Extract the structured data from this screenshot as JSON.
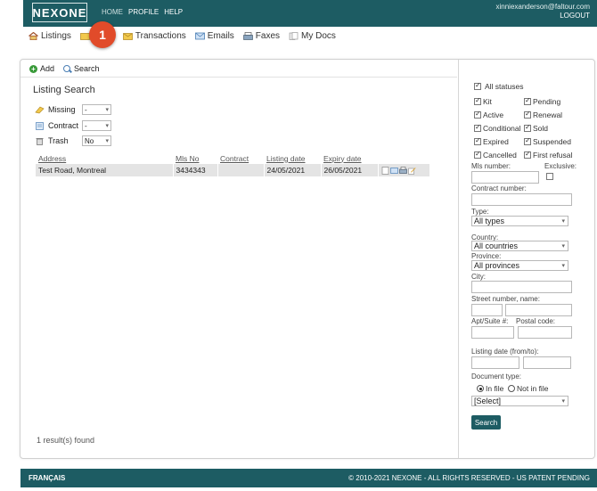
{
  "header": {
    "logo": "NEXONE",
    "nav": [
      "HOME",
      "PROFILE",
      "HELP"
    ],
    "user_email": "xinniexanderson@faltour.com",
    "logout": "LOGOUT"
  },
  "subnav": {
    "items": [
      {
        "label": "Listings",
        "icon": "house-icon"
      },
      {
        "label": "",
        "icon": "folder-icon"
      },
      {
        "label": "Transactions",
        "icon": "envelope-folder-icon"
      },
      {
        "label": "Emails",
        "icon": "email-icon"
      },
      {
        "label": "Faxes",
        "icon": "fax-icon"
      },
      {
        "label": "My Docs",
        "icon": "docs-icon"
      }
    ],
    "badge": "1"
  },
  "toolbar": {
    "add": "Add",
    "search": "Search"
  },
  "listing_search": {
    "title": "Listing Search",
    "filters": [
      {
        "label": "Missing",
        "value": "-"
      },
      {
        "label": "Contract",
        "value": "-"
      },
      {
        "label": "Trash",
        "value": "No"
      }
    ]
  },
  "results": {
    "columns": [
      "Address",
      "Mls No",
      "Contract",
      "Listing date",
      "Expiry date"
    ],
    "rows": [
      {
        "address": "Test Road, Montreal",
        "mls": "3434343",
        "contract": "",
        "listing_date": "24/05/2021",
        "expiry_date": "26/05/2021"
      }
    ],
    "count_text": "1 result(s) found"
  },
  "side": {
    "all_statuses": "All statuses",
    "statuses": [
      {
        "label": "Kit",
        "checked": true
      },
      {
        "label": "Pending",
        "checked": true
      },
      {
        "label": "Active",
        "checked": true
      },
      {
        "label": "Renewal",
        "checked": true
      },
      {
        "label": "Conditional",
        "checked": true
      },
      {
        "label": "Sold",
        "checked": true
      },
      {
        "label": "Expired",
        "checked": true
      },
      {
        "label": "Suspended",
        "checked": true
      },
      {
        "label": "Cancelled",
        "checked": true
      },
      {
        "label": "First refusal",
        "checked": true
      }
    ],
    "mls_number": "Mls number:",
    "exclusive": "Exclusive:",
    "contract_number": "Contract number:",
    "type_label": "Type:",
    "type_value": "All types",
    "country_label": "Country:",
    "country_value": "All countries",
    "province_label": "Province:",
    "province_value": "All provinces",
    "city_label": "City:",
    "street_label": "Street number, name:",
    "apt_label": "Apt/Suite #:",
    "postal_label": "Postal code:",
    "listing_date_label": "Listing date (from/to):",
    "doc_type_label": "Document type:",
    "in_file": "In file",
    "not_in_file": "Not in file",
    "doc_select": "[Select]",
    "search_button": "Search"
  },
  "footer": {
    "language": "FRANÇAIS",
    "copyright": "© 2010-2021 NEXONE - ALL RIGHTS RESERVED - US PATENT PENDING"
  },
  "colors": {
    "brand": "#1d5c63",
    "badge": "#e14b2a"
  }
}
